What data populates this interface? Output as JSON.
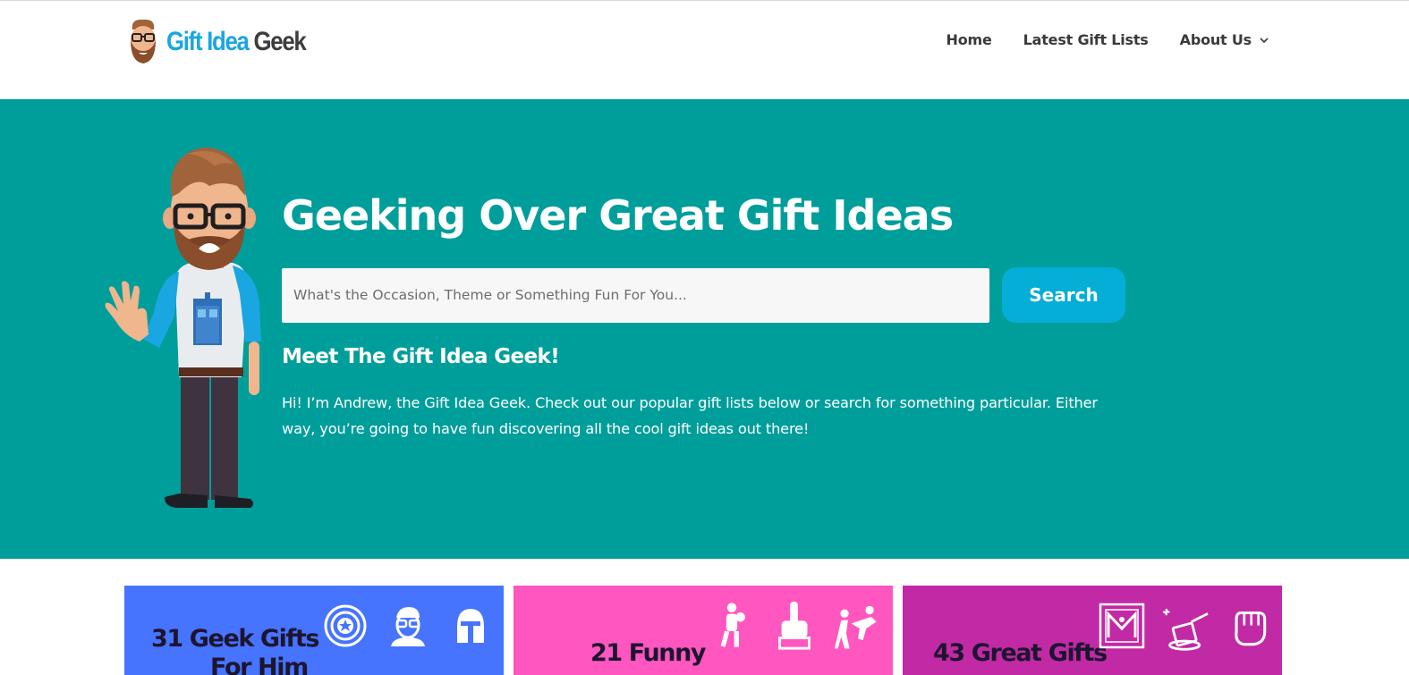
{
  "header": {
    "logo": {
      "part1": "Gift Idea",
      "part2": "Geek"
    },
    "nav": [
      {
        "label": "Home"
      },
      {
        "label": "Latest Gift Lists"
      },
      {
        "label": "About Us",
        "icon": "chevron-down-icon"
      }
    ]
  },
  "hero": {
    "title": "Geeking Over Great Gift Ideas",
    "search": {
      "placeholder": "What's the Occasion, Theme or Something Fun For You...",
      "button_label": "Search"
    },
    "subtitle": "Meet The Gift Idea Geek!",
    "intro": "Hi! I’m Andrew, the Gift Idea Geek. Check out our popular gift lists below or search for something particular. Either way, you’re going to have fun discovering all the cool gift ideas out there!"
  },
  "cards": [
    {
      "title_line1": "31 Geek Gifts",
      "title_line2": "For Him",
      "color": "#4674ff",
      "icons": [
        "captain-shield-icon",
        "nerd-face-icon",
        "mandalorian-helmet-icon"
      ]
    },
    {
      "title_line1": "21 Funny",
      "title_line2": "",
      "color": "#ff56c0",
      "icons": [
        "boxer-icon",
        "middle-finger-icon",
        "fighting-icon"
      ]
    },
    {
      "title_line1": "43 Great Gifts",
      "title_line2": "",
      "color": "#c12aa4",
      "icons": [
        "ornate-card-icon",
        "magic-hat-icon",
        "fist-icon"
      ]
    }
  ],
  "colors": {
    "hero_bg": "#009e9b",
    "accent": "#04aed7",
    "logo_blue": "#1aa6e0"
  }
}
